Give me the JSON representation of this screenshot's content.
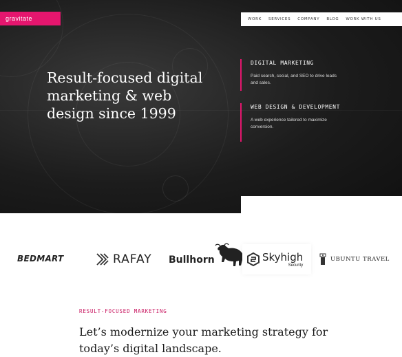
{
  "brand": {
    "logo_text": "gravitate",
    "accent": "#e5166e"
  },
  "nav": {
    "items": [
      "WORK",
      "SERVICES",
      "COMPANY",
      "BLOG",
      "WORK WITH US"
    ]
  },
  "hero": {
    "headline": "Result-focused digital marketing & web design since 1999",
    "services": [
      {
        "title": "DIGITAL MARKETING",
        "description": "Paid search, social, and SEO to drive leads and sales."
      },
      {
        "title": "WEB DESIGN & DEVELOPMENT",
        "description": "A web experience tailored to maximize conversion."
      }
    ]
  },
  "clients": {
    "bedmart": "BEDMART",
    "rafay": "RAFAY",
    "bullhorn": "Bullhorn",
    "skyhigh": {
      "name": "Skyhigh",
      "sub": "Security"
    },
    "ubuntu": "UBUNTU TRAVEL"
  },
  "intro": {
    "eyebrow": "RESULT-FOCUSED MARKETING",
    "title": "Let’s modernize your marketing strategy for today’s digital landscape."
  }
}
